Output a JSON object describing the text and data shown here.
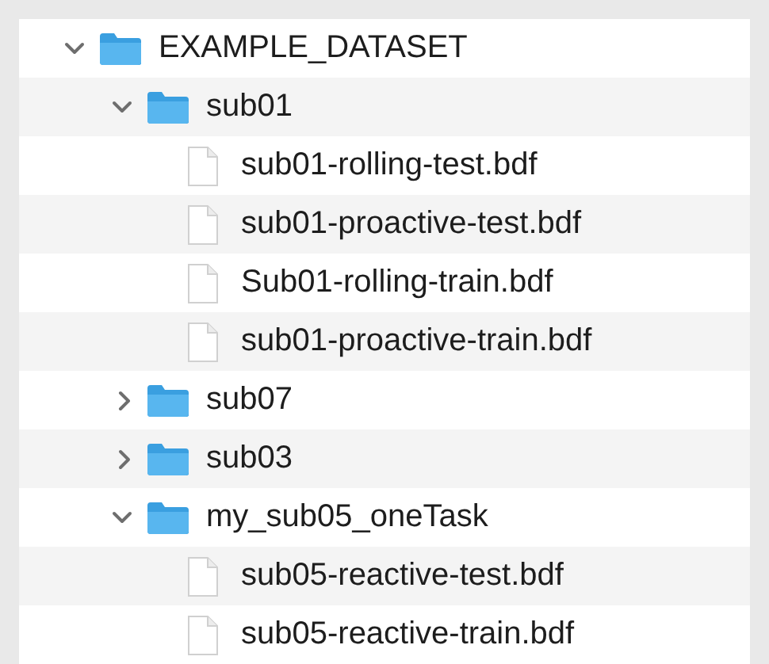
{
  "tree": [
    {
      "kind": "folder",
      "label": "EXAMPLE_DATASET",
      "expanded": true,
      "children": [
        {
          "kind": "folder",
          "label": "sub01",
          "expanded": true,
          "children": [
            {
              "kind": "file",
              "label": "sub01-rolling-test.bdf"
            },
            {
              "kind": "file",
              "label": "sub01-proactive-test.bdf"
            },
            {
              "kind": "file",
              "label": "Sub01-rolling-train.bdf"
            },
            {
              "kind": "file",
              "label": "sub01-proactive-train.bdf"
            }
          ]
        },
        {
          "kind": "folder",
          "label": "sub07",
          "expanded": false
        },
        {
          "kind": "folder",
          "label": "sub03",
          "expanded": false
        },
        {
          "kind": "folder",
          "label": "my_sub05_oneTask",
          "expanded": true,
          "children": [
            {
              "kind": "file",
              "label": "sub05-reactive-test.bdf"
            },
            {
              "kind": "file",
              "label": "sub05-reactive-train.bdf"
            }
          ]
        }
      ]
    }
  ]
}
